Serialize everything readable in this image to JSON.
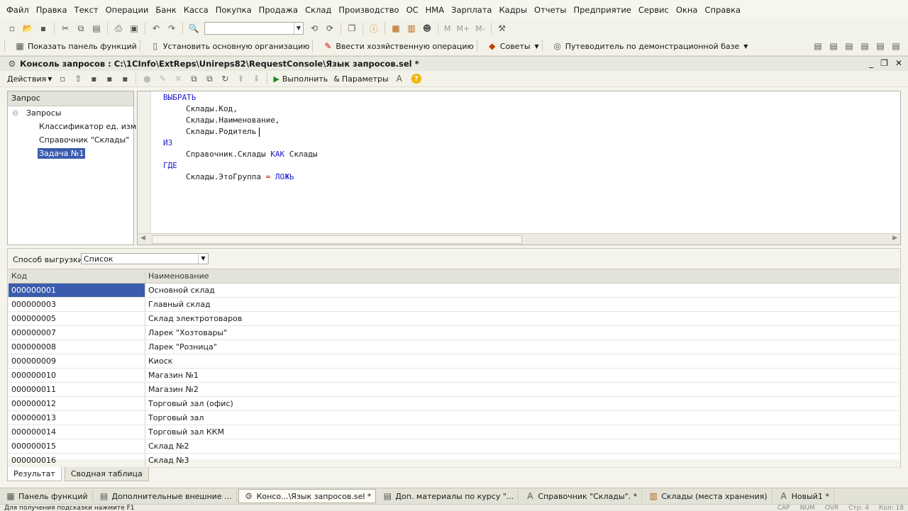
{
  "menu": [
    "Файл",
    "Правка",
    "Текст",
    "Операции",
    "Банк",
    "Касса",
    "Покупка",
    "Продажа",
    "Склад",
    "Производство",
    "ОС",
    "НМА",
    "Зарплата",
    "Кадры",
    "Отчеты",
    "Предприятие",
    "Сервис",
    "Окна",
    "Справка"
  ],
  "toolbar1": {
    "zoom_labels": [
      "M",
      "M+",
      "M-"
    ]
  },
  "toolbar2": {
    "show_panel": "Показать панель функций",
    "set_org": "Установить основную организацию",
    "enter_op": "Ввести хозяйственную операцию",
    "tips": "Советы",
    "guide": "Путеводитель по демонстрационной базе"
  },
  "window": {
    "title": "Консоль запросов : C:\\1CInfo\\ExtReps\\Unireps82\\RequestConsole\\Язык запросов.sel *",
    "actions": "Действия",
    "run": "Выполнить",
    "params": "Параметры"
  },
  "tree": {
    "header": "Запрос",
    "root": "Запросы",
    "items": [
      "Классификатор ед. изм.",
      "Справочник \"Склады\"",
      "Задача №1"
    ]
  },
  "editor": {
    "l1": "ВЫБРАТЬ",
    "l2": "Склады.Код,",
    "l3": "Склады.Наименование,",
    "l4": "Склады.Родитель",
    "l5": "ИЗ",
    "l6a": "Справочник.Склады ",
    "l6b": "КАК",
    "l6c": " Склады",
    "l7": "ГДЕ",
    "l8a": "Склады.ЭтоГруппа ",
    "l8b": "=",
    "l8c": " ЛОЖЬ"
  },
  "results": {
    "export_label": "Способ выгрузки:",
    "export_value": "Список",
    "columns": [
      "Код",
      "Наименование"
    ],
    "rows": [
      [
        "000000001",
        "Основной склад"
      ],
      [
        "000000003",
        "Главный склад"
      ],
      [
        "000000005",
        "Склад электротоваров"
      ],
      [
        "000000007",
        "Ларек \"Хозтовары\""
      ],
      [
        "000000008",
        "Ларек \"Розница\""
      ],
      [
        "000000009",
        "Киоск"
      ],
      [
        "000000010",
        "Магазин №1"
      ],
      [
        "000000011",
        "Магазин №2"
      ],
      [
        "000000012",
        "Торговый зал (офис)"
      ],
      [
        "000000013",
        "Торговый зал"
      ],
      [
        "000000014",
        "Торговый зал ККМ"
      ],
      [
        "000000015",
        "Склад №2"
      ],
      [
        "000000016",
        "Склад №3"
      ]
    ]
  },
  "tabs": [
    "Результат",
    "Сводная таблица"
  ],
  "taskbar": [
    "Панель функций",
    "Дополнительные внешние ...",
    "Консо...\\Язык запросов.sel *",
    "Доп. материалы по курсу \"...",
    "Справочник \"Склады\". *",
    "Склады (места хранения)",
    "Новый1 *"
  ],
  "statusbar": {
    "hint": "Для получения подсказки нажмите F1",
    "cap": "CAP",
    "num": "NUM",
    "ovr": "OVR",
    "line": "Стр: 4",
    "col": "Кол: 18"
  }
}
